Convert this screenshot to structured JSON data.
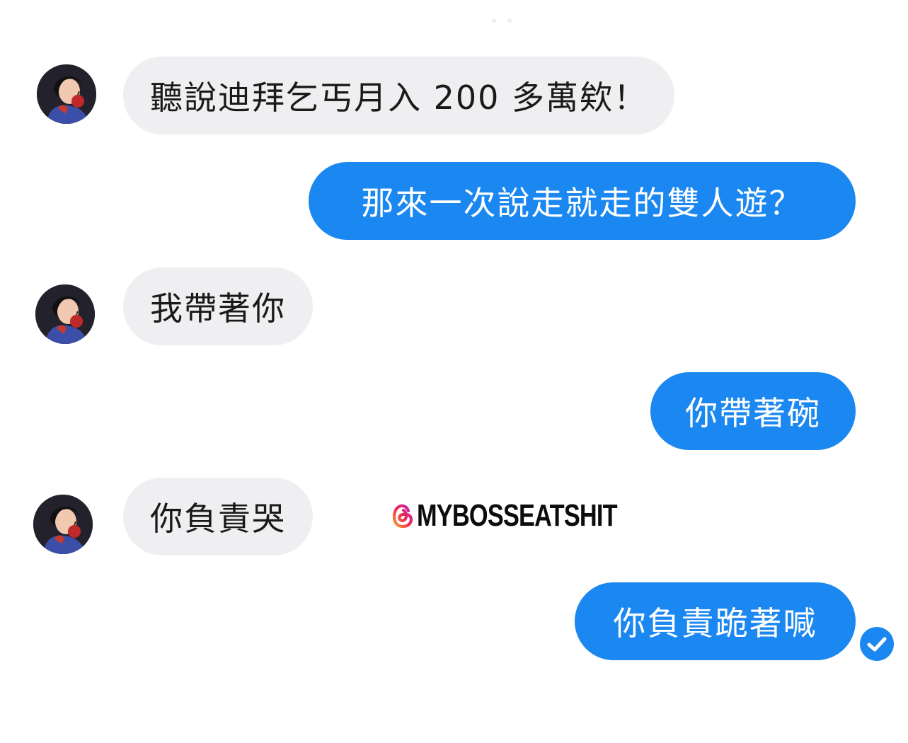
{
  "conversation": {
    "messages": [
      {
        "sender": "them",
        "text": "聽說迪拜乞丐月入 200 多萬欸！"
      },
      {
        "sender": "me",
        "text": "那來一次說走就走的雙人遊？"
      },
      {
        "sender": "them",
        "text": "我帶著你"
      },
      {
        "sender": "me",
        "text": "你帶著碗"
      },
      {
        "sender": "them",
        "text": "你負責哭"
      },
      {
        "sender": "me",
        "text": "你負責跪著喊"
      }
    ]
  },
  "watermark": {
    "handle": "@MYBOSSEATSHIT",
    "display_text": "MYBOSSEATSHIT",
    "icon": "threads-logo-icon"
  },
  "avatar": {
    "icon": "snow-white-avatar"
  },
  "read_receipt": {
    "icon": "check-circle-icon",
    "status": "read"
  },
  "colors": {
    "outgoing_bubble": "#1b87f0",
    "incoming_bubble": "#efeff1",
    "incoming_text": "#1a1a1a",
    "outgoing_text": "#ffffff",
    "background": "#ffffff"
  }
}
